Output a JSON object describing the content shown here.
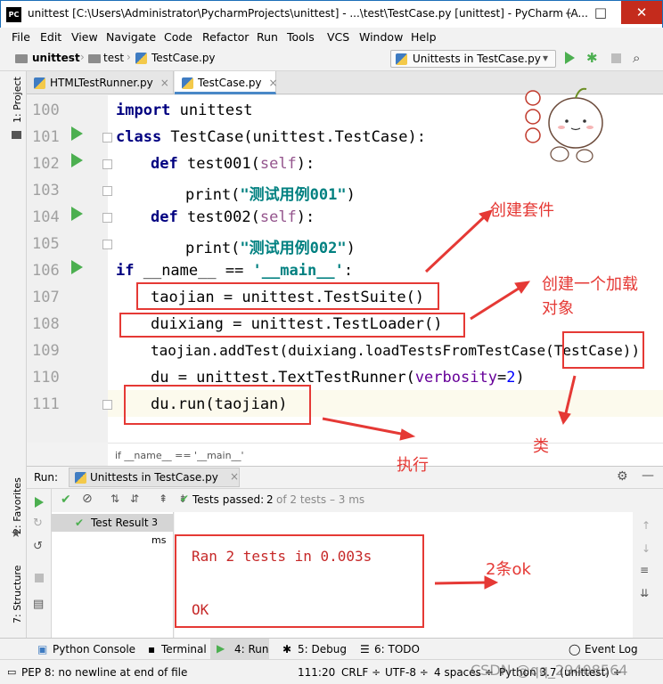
{
  "window": {
    "logo": "PC",
    "title": "unittest [C:\\Users\\Administrator\\PycharmProjects\\unittest] - ...\\test\\TestCase.py [unittest] - PyCharm (A..."
  },
  "menu": [
    "File",
    "Edit",
    "View",
    "Navigate",
    "Code",
    "Refactor",
    "Run",
    "Tools",
    "VCS",
    "Window",
    "Help"
  ],
  "nav": {
    "project": "unittest",
    "folder": "test",
    "file": "TestCase.py",
    "run_config": "Unittests in TestCase.py"
  },
  "side_tools": {
    "project": "1: Project",
    "favorites": "2: Favorites",
    "structure": "7: Structure"
  },
  "tabs": [
    {
      "label": "HTMLTestRunner.py",
      "close": "×"
    },
    {
      "label": "TestCase.py",
      "close": "×"
    }
  ],
  "editor": {
    "lines": [
      {
        "num": "100",
        "text": "import unittest"
      },
      {
        "num": "101",
        "text": "class TestCase(unittest.TestCase):"
      },
      {
        "num": "102",
        "text": "def test001(self):"
      },
      {
        "num": "103",
        "text": "print(\"测试用例001\")"
      },
      {
        "num": "104",
        "text": "def test002(self):"
      },
      {
        "num": "105",
        "text": "print(\"测试用例002\")"
      },
      {
        "num": "106",
        "text": "if __name__ == '__main__':"
      },
      {
        "num": "107",
        "text": "taojian = unittest.TestSuite()"
      },
      {
        "num": "108",
        "text": "duixiang = unittest.TestLoader()"
      },
      {
        "num": "109",
        "text": "taojian.addTest(duixiang.loadTestsFromTestCase(TestCase))"
      },
      {
        "num": "110",
        "text": "du = unittest.TextTestRunner(verbosity=2)"
      },
      {
        "num": "111",
        "text": "du.run(taojian)"
      }
    ],
    "breadcrumb": "if __name__ == '__main__'"
  },
  "run": {
    "label": "Run:",
    "config": "Unittests in TestCase.py",
    "status_prefix": "Tests passed:",
    "status_count": "2",
    "status_rest": "of 2 tests – 3 ms",
    "tree_item": "Test Result",
    "tree_time": "3 ms",
    "console_line1": "Ran 2 tests in 0.003s",
    "console_line2": "OK"
  },
  "bottom_tools": [
    {
      "label": "Python Console"
    },
    {
      "label": "Terminal"
    },
    {
      "label": "4: Run"
    },
    {
      "label": "5: Debug"
    },
    {
      "label": "6: TODO"
    },
    {
      "label": "Event Log"
    }
  ],
  "status": {
    "message": "PEP 8: no newline at end of file",
    "position": "111:20",
    "line_sep": "CRLF ÷",
    "encoding": "UTF-8 ÷",
    "indent": "4 spaces ÷",
    "interpreter": "Python 3.7 (unittest) ÷",
    "watermark": "CSDN @qq_29408564"
  },
  "annotations": {
    "create_suite": "创建套件",
    "create_loader_1": "创建一个加载",
    "create_loader_2": "对象",
    "class": "类",
    "execute": "执行",
    "two_ok": "2条ok"
  },
  "colors": {
    "accent": "#4a88c7",
    "annotation": "#e53935",
    "run_green": "#4caf50"
  }
}
